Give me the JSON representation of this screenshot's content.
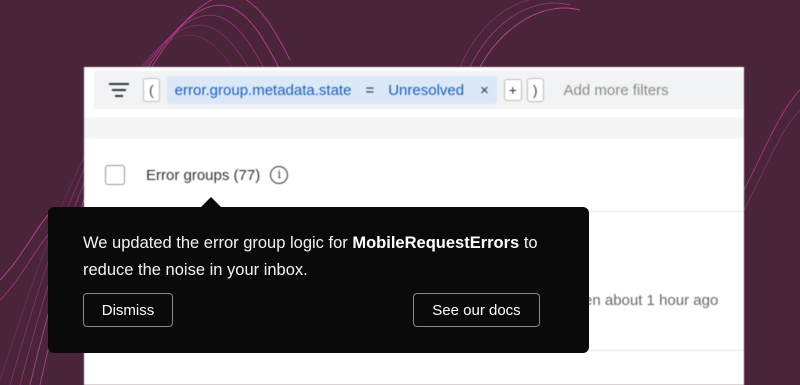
{
  "filter_bar": {
    "open_paren": "(",
    "chip": {
      "field": "error.group.metadata.state",
      "operator": "=",
      "value": "Unresolved",
      "remove": "×"
    },
    "plus": "+",
    "close_paren": ")",
    "add_more": "Add more filters"
  },
  "groups": {
    "title": "Error groups (77)",
    "info": "i"
  },
  "row": {
    "timestamp": "en about 1 hour ago"
  },
  "tooltip": {
    "message_prefix": "We updated the error group logic for ",
    "message_bold": "MobileRequestErrors",
    "message_suffix": " to reduce the noise in your inbox.",
    "dismiss": "Dismiss",
    "docs": "See our docs"
  },
  "colors": {
    "background": "#4a2438",
    "accent_wave": "#d04aa8",
    "tooltip_bg": "#0a0a0a",
    "chip_bg": "#dbe8f8",
    "chip_text": "#1a5fb4"
  },
  "icons": {
    "filter": "filter-lines-icon",
    "info": "info-circle-icon",
    "close": "close-icon"
  }
}
